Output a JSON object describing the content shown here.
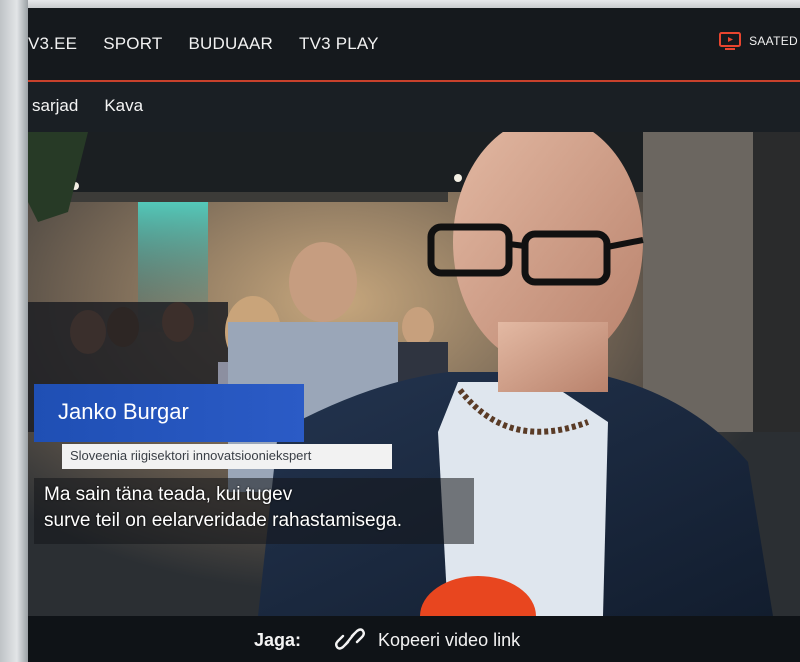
{
  "nav": {
    "items": [
      "V3.EE",
      "SPORT",
      "BUDUAAR",
      "TV3 PLAY"
    ],
    "right_label": "SAATED",
    "right_icon": "tv-icon",
    "accent_color": "#c8412c"
  },
  "subnav": {
    "items": [
      "sarjad",
      "Kava"
    ]
  },
  "video": {
    "lower_third": {
      "name": "Janko Burgar",
      "title": "Sloveenia riigisektori innovatsiooniekspert",
      "name_bg": "#2550bc"
    },
    "subtitles": [
      "Ma sain täna teada, kui tugev",
      "surve teil on eelarveridade rahastamisega."
    ]
  },
  "share": {
    "label": "Jaga:",
    "link_icon": "link-icon",
    "link_label": "Kopeeri video link"
  }
}
